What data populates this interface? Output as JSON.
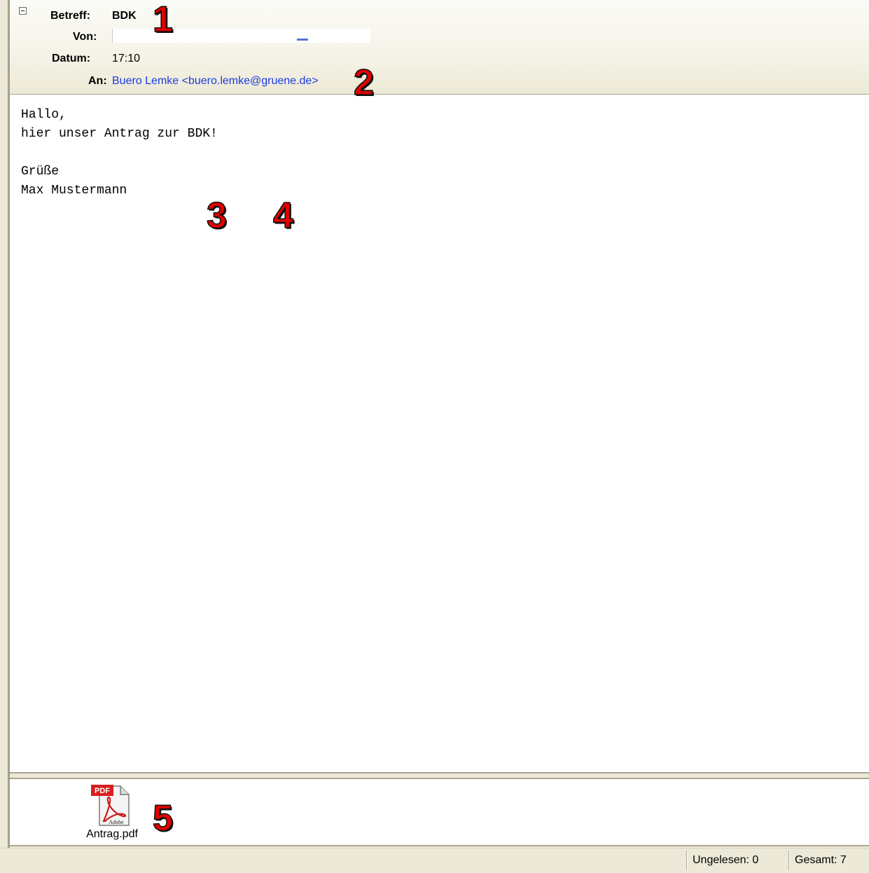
{
  "header": {
    "subject_label": "Betreff:",
    "subject_value": "BDK",
    "from_label": "Von:",
    "date_label": "Datum:",
    "date_value": "17:10",
    "to_label": "An:",
    "to_value": "Buero Lemke <buero.lemke@gruene.de>"
  },
  "body": {
    "text": "Hallo,\nhier unser Antrag zur BDK!\n\nGrüße\nMax Mustermann"
  },
  "attachment": {
    "filename": "Antrag.pdf",
    "icon_badge": "PDF",
    "icon_label": "Adobe"
  },
  "statusbar": {
    "unread": "Ungelesen: 0",
    "total": "Gesamt: 7"
  },
  "annotations": [
    "1",
    "2",
    "3",
    "4",
    "5"
  ],
  "colors": {
    "link": "#1a3ce0",
    "annotation": "#e00000"
  }
}
